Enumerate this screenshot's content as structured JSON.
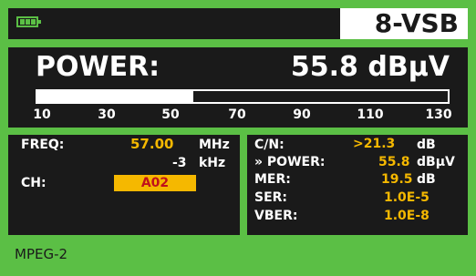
{
  "header": {
    "modulation": "8-VSB",
    "battery_icon": "battery-icon"
  },
  "power": {
    "label": "POWER:",
    "value": "55.8 dBµV",
    "level_fraction": 0.38,
    "scale": [
      "10",
      "30",
      "50",
      "70",
      "90",
      "110",
      "130"
    ]
  },
  "left": {
    "freq_label": "FREQ:",
    "freq_value": "57.00",
    "freq_unit": "MHz",
    "offset_value": "-3",
    "offset_unit": "kHz",
    "ch_label": "CH:",
    "ch_value": "A02"
  },
  "right": {
    "cn_label": "C/N:",
    "cn_value": ">21.3",
    "cn_unit": "dB",
    "power_label": "» POWER:",
    "power_value": "55.8",
    "power_unit": "dBµV",
    "mer_label": "MER:",
    "mer_value": "19.5",
    "mer_unit": "dB",
    "ser_label": "SER:",
    "ser_value": "1.0E-5",
    "vber_label": "VBER:",
    "vber_value": "1.0E-8"
  },
  "footer": {
    "mode": "MPEG-2"
  },
  "colors": {
    "frame": "#5bbf45",
    "panel": "#1a1a1a",
    "value": "#f5b800",
    "channel_text": "#c0101a"
  }
}
